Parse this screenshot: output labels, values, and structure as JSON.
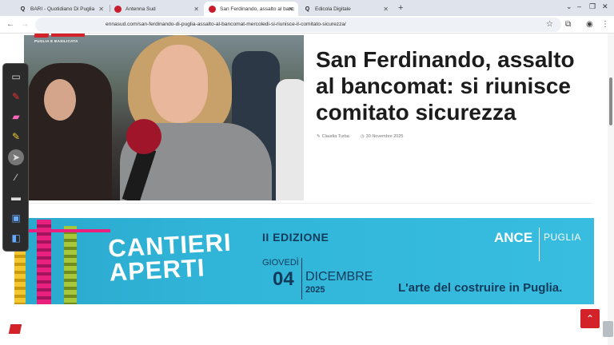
{
  "browser": {
    "tabs": [
      {
        "label": "BARI - Quotidiano Di Puglia",
        "favicon": "Q"
      },
      {
        "label": "Antenna Sud",
        "favicon": "A"
      },
      {
        "label": "San Ferdinando, assalto al banc",
        "favicon": "N",
        "active": true
      },
      {
        "label": "Edicola Digitale",
        "favicon": "Q"
      }
    ],
    "new_tab": "+",
    "window_controls": {
      "minimize": "⌄",
      "restore": "–",
      "maximize": "❐",
      "close": "✕"
    },
    "url": "ennasud.com/san-ferdinando-di-puglia-assalto-al-bancomat-mercoledi-si-riunisce-il-comitato-sicurezza/",
    "nav": {
      "back": "←",
      "forward": "→",
      "reload": "⟳"
    }
  },
  "site": {
    "logo_text": "news",
    "logo_sub": "PUGLIA E BASILICATA"
  },
  "article": {
    "headline": "San Ferdinando, assalto al bancomat: si riunisce comitato sicurezza",
    "author": "Claudia Turba",
    "date": "30 Novembre 2025"
  },
  "banner": {
    "title": "CANTIERI APERTI",
    "edition": "II EDIZIONE",
    "weekday": "GIOVEDÌ",
    "day": "04",
    "month": "DICEMBRE",
    "year": "2025",
    "org": "ANCE",
    "region": "PUGLIA",
    "tagline": "L'arte del costruire in Puglia."
  },
  "colors": {
    "brand_red": "#d4222a",
    "banner_blue": "#31b6d9",
    "banner_navy": "#123a5a"
  },
  "annotation_tools": [
    "screen-icon",
    "pen-icon",
    "eraser-icon",
    "highlighter-icon",
    "pointer-icon",
    "brush-icon",
    "line-icon",
    "whiteboard-icon",
    "capture-icon"
  ]
}
